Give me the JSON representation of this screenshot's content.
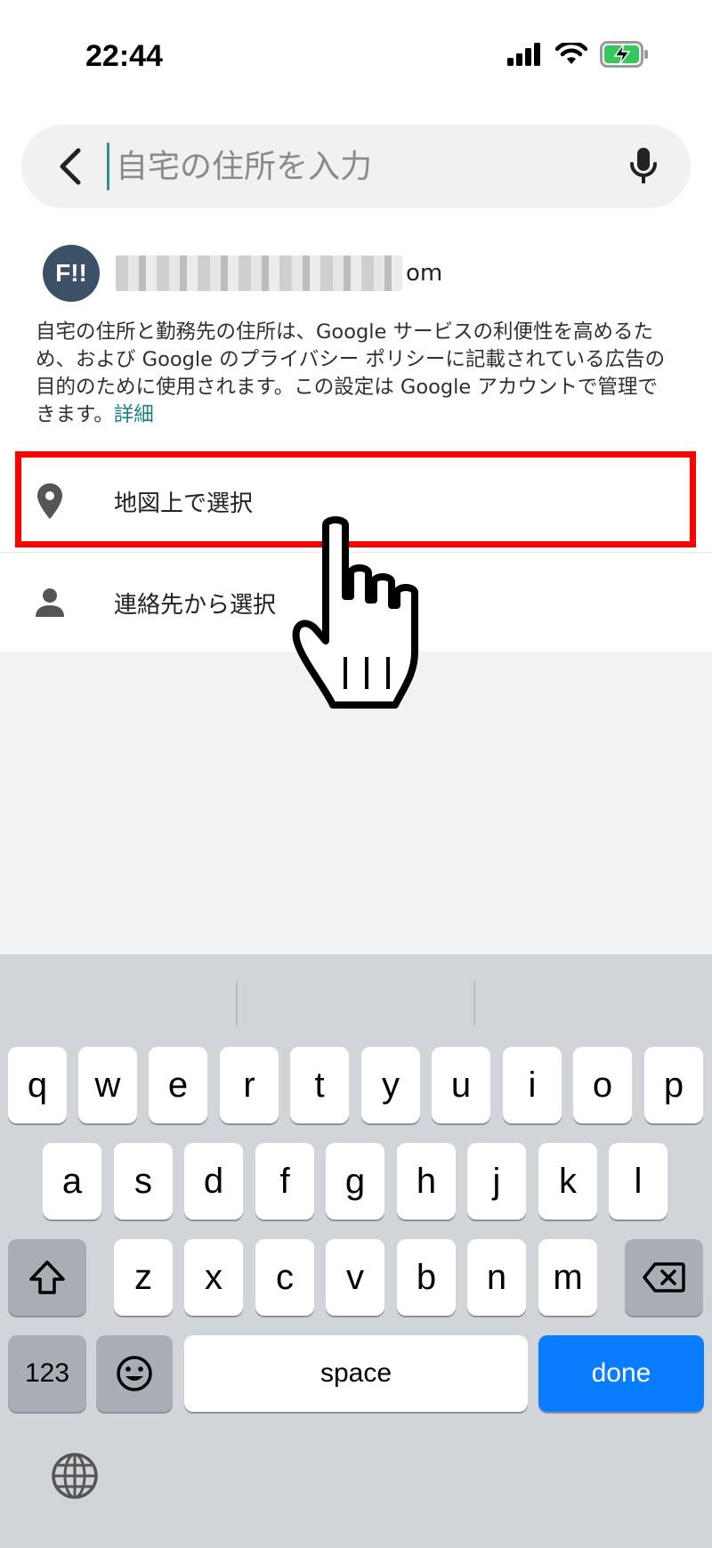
{
  "status_bar": {
    "time": "22:44"
  },
  "search": {
    "placeholder": "自宅の住所を入力",
    "value": ""
  },
  "account": {
    "avatar_text": "F!!",
    "email_suffix": "om"
  },
  "privacy": {
    "text": "自宅の住所と勤務先の住所は、Google サービスの利便性を高めるため、および Google のプライバシー ポリシーに記載されている広告の目的のために使用されます。この設定は Google アカウントで管理できます。",
    "link_label": "詳細"
  },
  "options": [
    {
      "label": "地図上で選択",
      "icon": "location-pin-icon"
    },
    {
      "label": "連絡先から選択",
      "icon": "person-icon"
    }
  ],
  "keyboard": {
    "row1": [
      "q",
      "w",
      "e",
      "r",
      "t",
      "y",
      "u",
      "i",
      "o",
      "p"
    ],
    "row2": [
      "a",
      "s",
      "d",
      "f",
      "g",
      "h",
      "j",
      "k",
      "l"
    ],
    "row3": [
      "z",
      "x",
      "c",
      "v",
      "b",
      "n",
      "m"
    ],
    "numbers_label": "123",
    "space_label": "space",
    "done_label": "done"
  },
  "colors": {
    "accent_link": "#1a7f86",
    "highlight": "#ff0000",
    "done_key": "#0a7cff",
    "avatar_bg": "#3c5068"
  }
}
